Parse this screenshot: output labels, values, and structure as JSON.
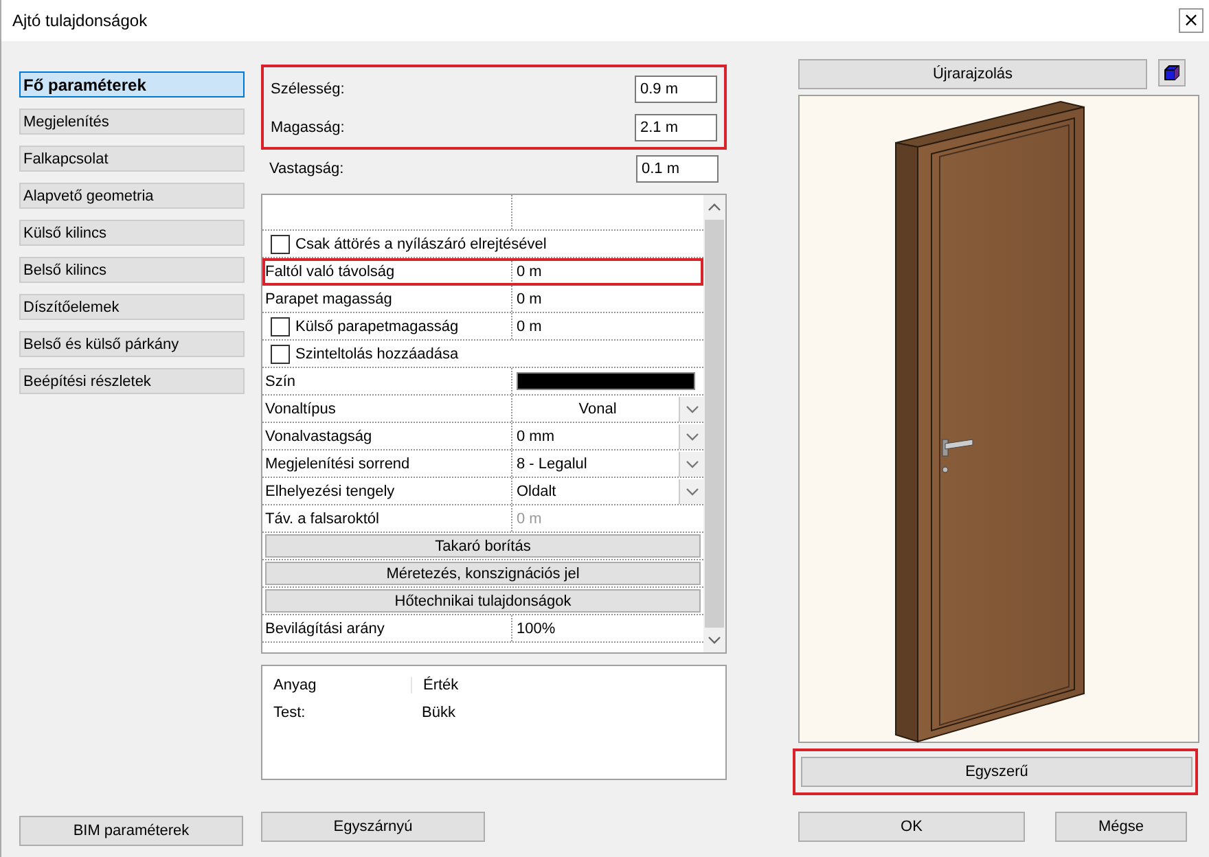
{
  "window": {
    "title": "Ajtó tulajdonságok",
    "close": "×"
  },
  "nav": [
    {
      "label": "Fő paraméterek",
      "selected": true
    },
    {
      "label": "Megjelenítés",
      "selected": false
    },
    {
      "label": "Falkapcsolat",
      "selected": false
    },
    {
      "label": "Alapvető geometria",
      "selected": false
    },
    {
      "label": "Külső kilincs",
      "selected": false
    },
    {
      "label": "Belső kilincs",
      "selected": false
    },
    {
      "label": "Díszítőelemek",
      "selected": false
    },
    {
      "label": "Belső és külső párkány",
      "selected": false
    },
    {
      "label": "Beépítési részletek",
      "selected": false
    }
  ],
  "dimensions": {
    "highlighted": true,
    "fields": [
      {
        "label": "Szélesség:",
        "value": "0.9 m"
      },
      {
        "label": "Magasság:",
        "value": "2.1 m"
      }
    ]
  },
  "thickness": {
    "label": "Vastagság:",
    "value": "0.1 m"
  },
  "properties": [
    {
      "kind": "header"
    },
    {
      "kind": "check",
      "label": "Csak áttörés a nyílászáró elrejtésével",
      "checked": false
    },
    {
      "kind": "value",
      "label": "Faltól való távolság",
      "value": "0 m",
      "highlighted": true,
      "disabled": false
    },
    {
      "kind": "value",
      "label": "Parapet magasság",
      "value": "0 m",
      "highlighted": false,
      "disabled": false
    },
    {
      "kind": "check",
      "label": "Külső parapetmagasság",
      "checked": false,
      "value": "0 m"
    },
    {
      "kind": "check",
      "label": "Szinteltolás hozzáadása",
      "checked": false
    },
    {
      "kind": "swatch",
      "label": "Szín"
    },
    {
      "kind": "dropdown",
      "label": "Vonaltípus",
      "value": "Vonal",
      "centered": true
    },
    {
      "kind": "dropdown",
      "label": "Vonalvastagság",
      "value": "0 mm",
      "centered": false
    },
    {
      "kind": "dropdown",
      "label": "Megjelenítési sorrend",
      "value": "8 - Legalul",
      "centered": false
    },
    {
      "kind": "dropdown",
      "label": "Elhelyezési tengely",
      "value": "Oldalt",
      "centered": false
    },
    {
      "kind": "value",
      "label": "Táv. a falsaroktól",
      "value": "0 m",
      "highlighted": false,
      "disabled": true
    },
    {
      "kind": "section",
      "label": "Takaró borítás"
    },
    {
      "kind": "section",
      "label": "Méretezés, konszignációs jel"
    },
    {
      "kind": "section",
      "label": "Hőtechnikai tulajdonságok"
    },
    {
      "kind": "value",
      "label": "Bevilágítási arány",
      "value": "100%",
      "highlighted": false,
      "disabled": false
    }
  ],
  "materials": {
    "columns": [
      "Anyag",
      "Érték"
    ],
    "rows": [
      [
        "Test:",
        "Bükk"
      ]
    ]
  },
  "left_buttons": [
    "BIM paraméterek",
    "Egyszárnyú"
  ],
  "preview": {
    "redraw": "Újrarajzolás",
    "mode": {
      "label": "Egyszerű",
      "highlighted": true
    }
  },
  "buttons": [
    "OK",
    "Mégse"
  ]
}
